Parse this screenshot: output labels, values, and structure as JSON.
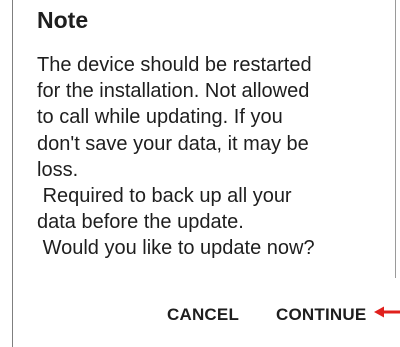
{
  "dialog": {
    "title": "Note",
    "message": "The device should be restarted\nfor the installation. Not allowed\nto call while updating. If you\ndon't save your data, it may be\nloss.\n Required to back up all your\ndata before the update.\n Would you like to update now?",
    "cancel_label": "CANCEL",
    "continue_label": "CONTINUE"
  },
  "colors": {
    "text": "#1e1e1e",
    "pointer_arrow": "#e0201d"
  },
  "icons": {
    "pointer": "red-arrow-pointer-icon"
  }
}
